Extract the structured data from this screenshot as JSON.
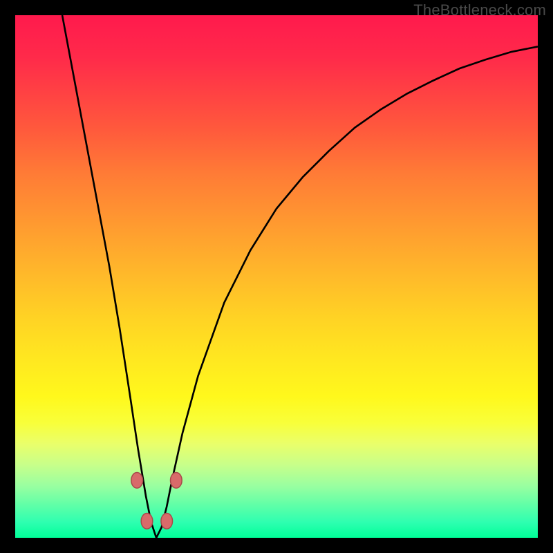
{
  "watermark": "TheBottleneck.com",
  "colors": {
    "background": "#000000",
    "gradient_top": "#ff1a4d",
    "gradient_bottom": "#00ff99",
    "curve": "#000000",
    "dots": "#d86a6a"
  },
  "chart_data": {
    "type": "line",
    "title": "",
    "xlabel": "",
    "ylabel": "",
    "xlim": [
      0,
      100
    ],
    "ylim": [
      0,
      100
    ],
    "note": "No axis ticks or numeric labels are shown; values are visual estimates on a 0–100 normalized scale. Curve is a V/cusp whose minimum reaches y≈0 near x≈27.",
    "series": [
      {
        "name": "curve",
        "x": [
          9,
          12,
          15,
          18,
          20,
          22,
          23.5,
          25,
          26,
          27,
          28,
          29,
          30,
          32,
          35,
          40,
          45,
          50,
          55,
          60,
          65,
          70,
          75,
          80,
          85,
          90,
          95,
          100
        ],
        "values": [
          100,
          84,
          68,
          52,
          40,
          27,
          17,
          8,
          3,
          0,
          2,
          6,
          11,
          20,
          31,
          45,
          55,
          63,
          69,
          74,
          78.5,
          82,
          85,
          87.5,
          89.8,
          91.5,
          93,
          94
        ]
      }
    ],
    "markers": [
      {
        "name": "dot-left-upper",
        "x": 23.3,
        "y": 11.0
      },
      {
        "name": "dot-left-lower",
        "x": 25.2,
        "y": 3.2
      },
      {
        "name": "dot-right-lower",
        "x": 29.0,
        "y": 3.2
      },
      {
        "name": "dot-right-upper",
        "x": 30.8,
        "y": 11.0
      }
    ]
  }
}
